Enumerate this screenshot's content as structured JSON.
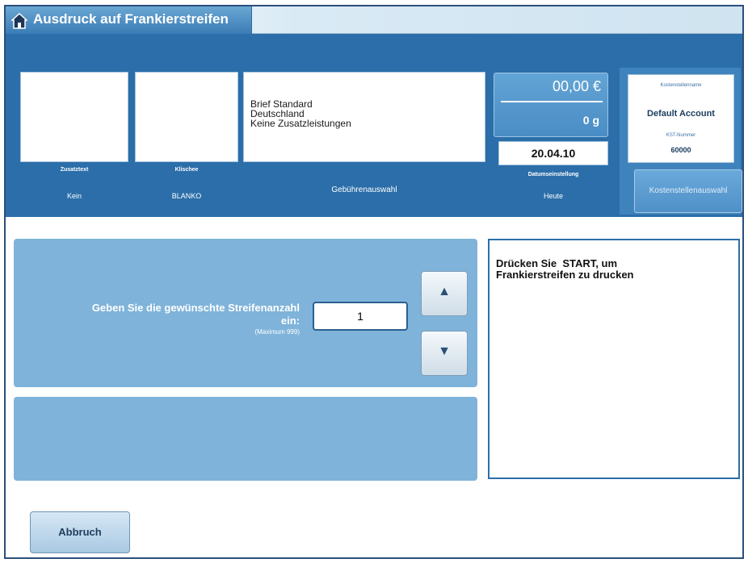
{
  "window": {
    "title": "Ausdruck auf Frankierstreifen"
  },
  "header": {
    "extra_box": {
      "caption": "Zusatztext",
      "value": "Kein"
    },
    "cliche_box": {
      "caption": "Klischee",
      "value": "BLANKO"
    },
    "rate_box": {
      "lines": [
        "Brief Standard",
        "Deutschland",
        "Keine Zusatzleistungen"
      ],
      "button_label": "Gebührenauswahl"
    },
    "amount": "00,00 €",
    "weight": "0 g",
    "date": "20.04.10",
    "date_caption": "Datumseinstellung",
    "date_value": "Heute",
    "account": {
      "label": "Kostenstellenname",
      "name": "Default Account",
      "number_label": "KST-Nummer",
      "number": "60000",
      "button_label": "Kostenstellenauswahl"
    }
  },
  "main": {
    "prompt_line1": "Geben Sie die gewünschte Streifenanzahl",
    "prompt_line2": "ein:",
    "prompt_hint": "(Maximum 999)",
    "quantity": "1",
    "up_symbol": "▲",
    "down_symbol": "▼",
    "info_line1": "Drücken Sie  START, um",
    "info_line2": "Frankierstreifen zu drucken"
  },
  "footer": {
    "cancel_label": "Abbruch"
  },
  "colors": {
    "accent": "#2b6ea9",
    "panel": "#7fb3da"
  }
}
